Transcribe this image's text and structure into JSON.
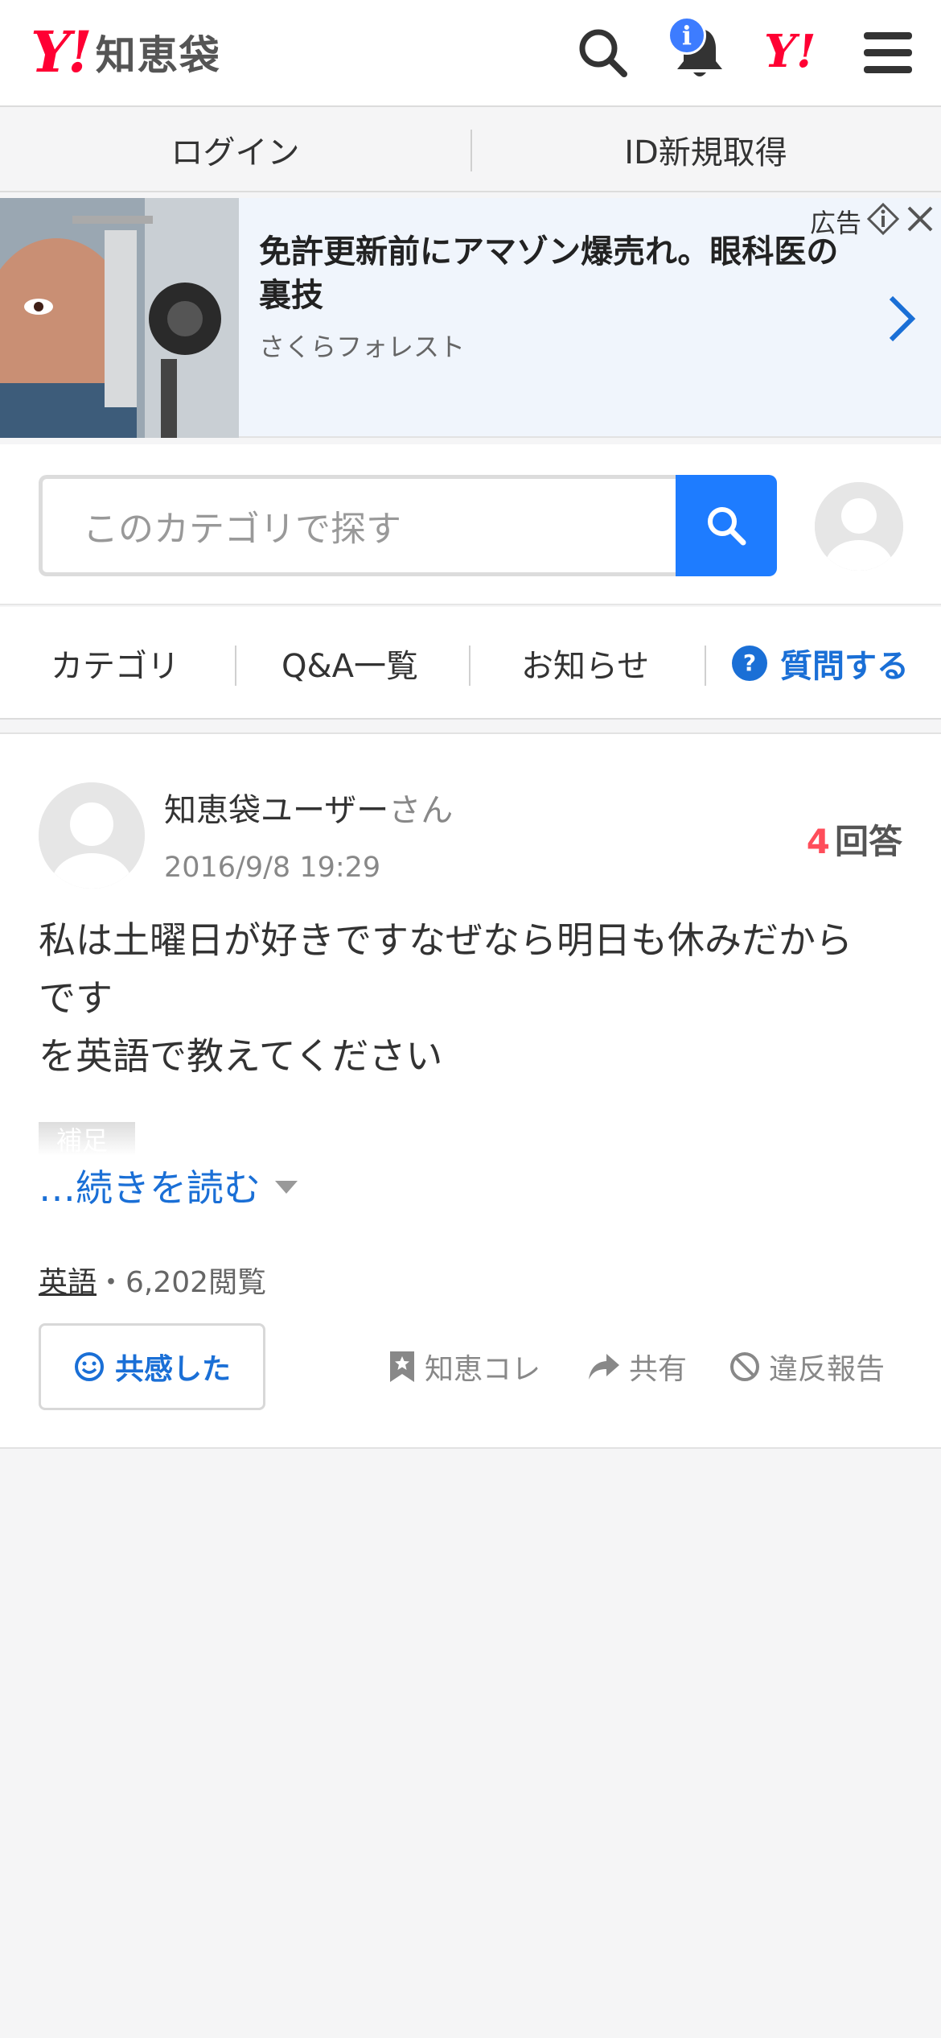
{
  "header": {
    "logo_mark": "Y!",
    "logo_text": "知恵袋",
    "notification_badge": "i",
    "yahoo_mark": "Y!"
  },
  "auth": {
    "login": "ログイン",
    "register": "ID新規取得"
  },
  "ad": {
    "title": "免許更新前にアマゾン爆売れ。眼科医の裏技",
    "sponsor": "さくらフォレスト",
    "label": "広告"
  },
  "search": {
    "placeholder": "このカテゴリで探す"
  },
  "nav": {
    "category": "カテゴリ",
    "qa_list": "Q&A一覧",
    "news": "お知らせ",
    "ask": "質問する"
  },
  "question": {
    "user": "知恵袋ユーザー",
    "user_suffix": "さん",
    "date": "2016/9/8 19:29",
    "answer_count": "4",
    "answer_label": "回答",
    "body": "私は土曜日が好きですなぜなら明日も休みだから\nです\nを英語で教えてください",
    "supplement_label": "補足",
    "read_more": "…続きを読む",
    "category": "英語",
    "views": "・6,202閲覧",
    "empathy": "共感した",
    "actions": {
      "save": "知恵コレ",
      "share": "共有",
      "report": "違反報告"
    }
  },
  "colors": {
    "brand_red": "#ff0033",
    "link_blue": "#1a6fd6",
    "search_blue": "#1e7cff",
    "answer_count_red": "#ff4d5a"
  }
}
